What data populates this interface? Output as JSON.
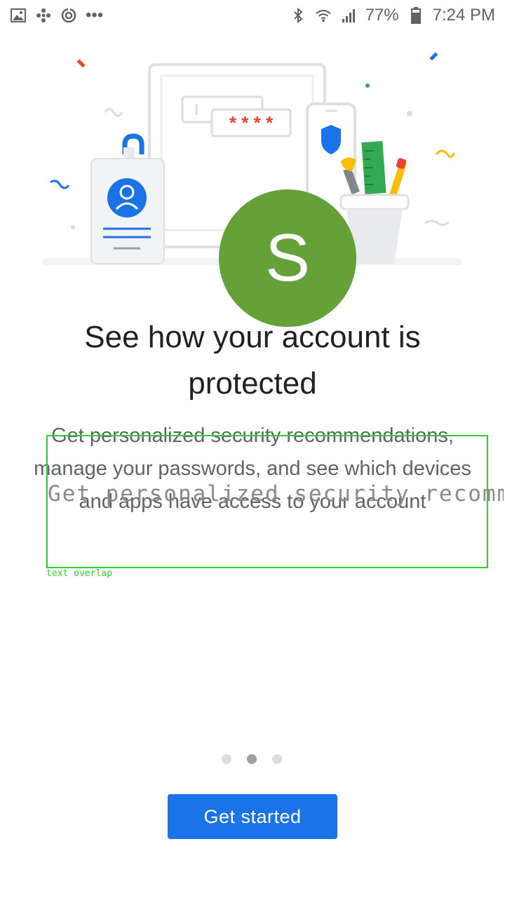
{
  "status_bar": {
    "left_icons": [
      "gallery-icon",
      "pinwheel-icon",
      "sync-icon",
      "more-icon"
    ],
    "more_glyph": "•••",
    "right_icons": [
      "bluetooth-icon",
      "wifi-icon",
      "signal-icon",
      "battery-icon"
    ],
    "battery": "77%",
    "time": "7:24 PM"
  },
  "illustration": {
    "avatar_letter": "S",
    "password_mask": "* * * *",
    "avatar_color": "#66a039"
  },
  "content": {
    "title": "See how your account is protected",
    "description": "Get personalized security recommendations, manage your passwords, and see which devices and apps have access to your account"
  },
  "debug_overlay": {
    "ghost_text": "Get personalized security recommendations",
    "label": "text overlap",
    "color": "#2bd52b"
  },
  "pager": {
    "pages": 3,
    "active": 2
  },
  "actions": {
    "primary_label": "Get started",
    "primary_color": "#1a73e8"
  }
}
